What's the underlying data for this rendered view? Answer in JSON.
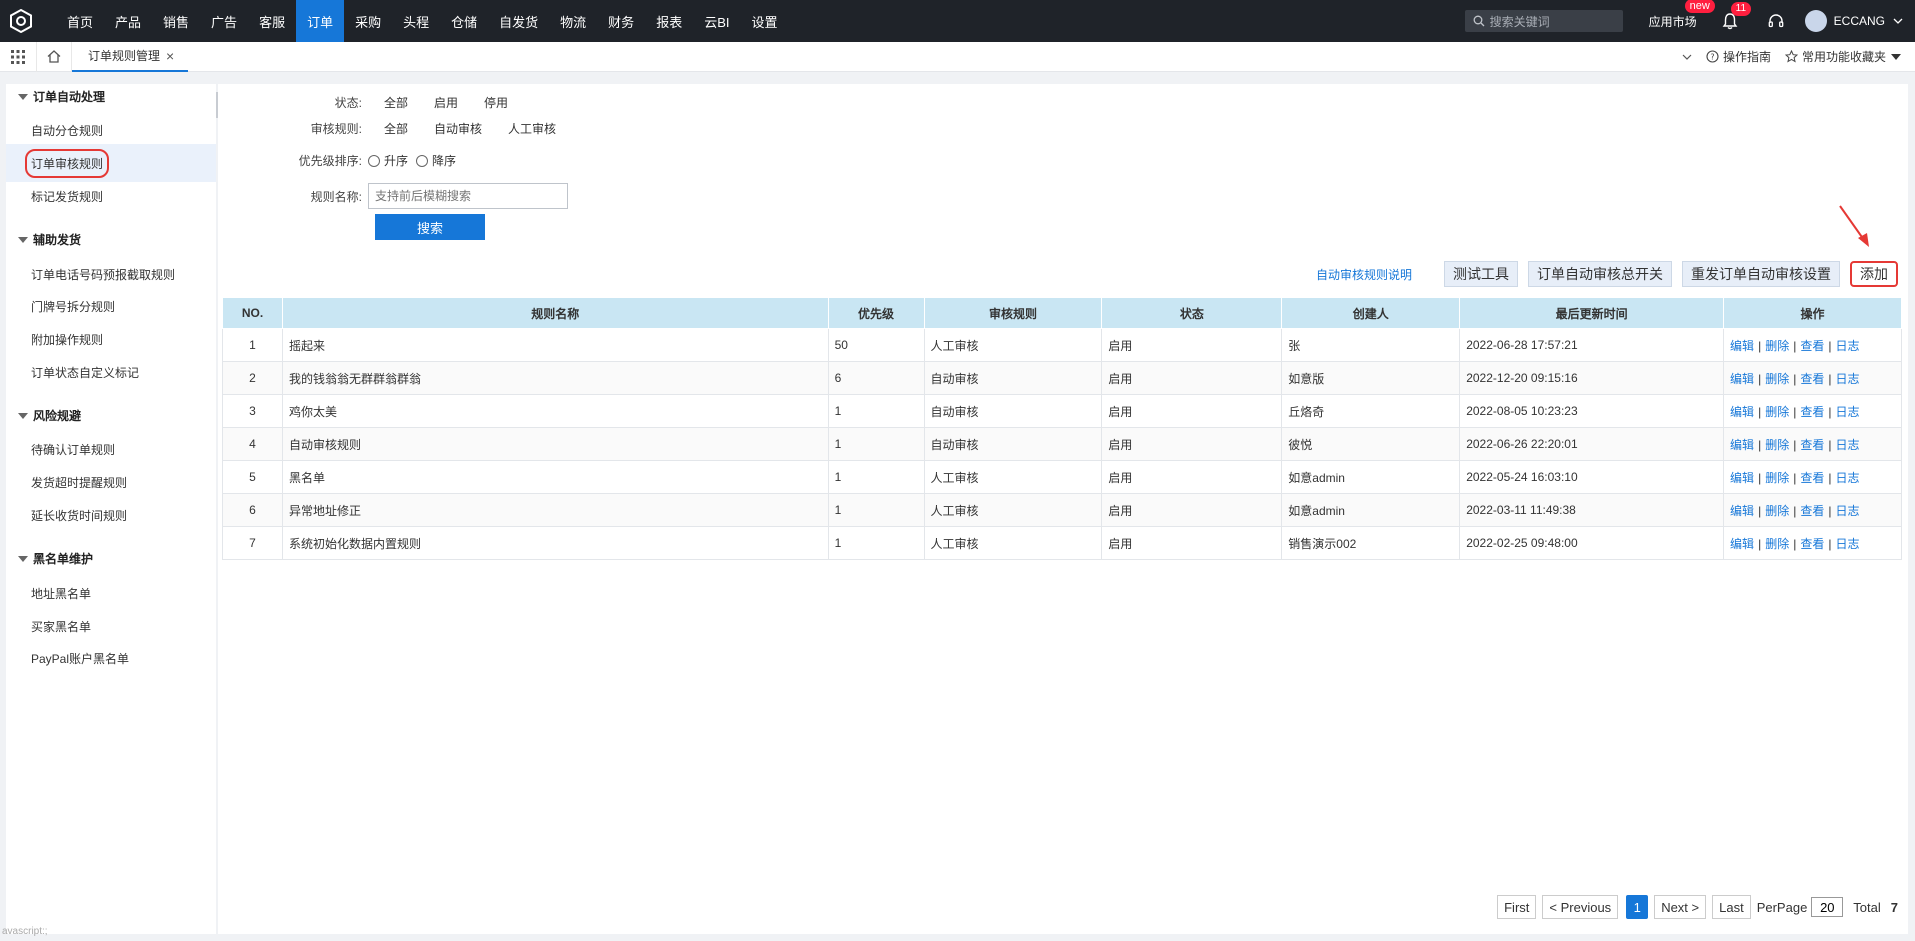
{
  "nav": {
    "menu": [
      "首页",
      "产品",
      "销售",
      "广告",
      "客服",
      "订单",
      "采购",
      "头程",
      "仓储",
      "自发货",
      "物流",
      "财务",
      "报表",
      "云BI",
      "设置"
    ],
    "active_index": 5,
    "search_placeholder": "搜索关键词",
    "app_market": "应用市场",
    "new_badge": "new",
    "notif_count": "11",
    "username": "ECCANG"
  },
  "tabbar": {
    "active_tab": "订单规则管理",
    "close": "×",
    "guide": "操作指南",
    "favorites": "常用功能收藏夹"
  },
  "sidebar": {
    "groups": [
      {
        "title": "订单自动处理",
        "items": [
          "自动分仓规则",
          "订单审核规则",
          "标记发货规则"
        ]
      },
      {
        "title": "辅助发货",
        "items": [
          "订单电话号码预报截取规则",
          "门牌号拆分规则",
          "附加操作规则",
          "订单状态自定义标记"
        ]
      },
      {
        "title": "风险规避",
        "items": [
          "待确认订单规则",
          "发货超时提醒规则",
          "延长收货时间规则"
        ]
      },
      {
        "title": "黑名单维护",
        "items": [
          "地址黑名单",
          "买家黑名单",
          "PayPal账户黑名单"
        ]
      }
    ],
    "active_item": "订单审核规则"
  },
  "filters": {
    "status_label": "状态:",
    "status_opts": [
      "全部",
      "启用",
      "停用"
    ],
    "rule_label": "审核规则:",
    "rule_opts": [
      "全部",
      "自动审核",
      "人工审核"
    ],
    "sort_label": "优先级排序:",
    "sort_asc": "升序",
    "sort_desc": "降序",
    "name_label": "规则名称:",
    "name_placeholder": "支持前后模糊搜索",
    "search_btn": "搜索"
  },
  "actions": {
    "help": "自动审核规则说明",
    "test_tool": "测试工具",
    "master_switch": "订单自动审核总开关",
    "resend": "重发订单自动审核设置",
    "add": "添加"
  },
  "table": {
    "headers": [
      "NO.",
      "规则名称",
      "优先级",
      "审核规则",
      "状态",
      "创建人",
      "最后更新时间",
      "操作"
    ],
    "rows": [
      [
        "1",
        "摇起来",
        "50",
        "人工审核",
        "启用",
        "张",
        "2022-06-28 17:57:21"
      ],
      [
        "2",
        "我的钱翁翁无群群翁群翁",
        "6",
        "自动审核",
        "启用",
        "如意版",
        "2022-12-20 09:15:16"
      ],
      [
        "3",
        "鸡你太美",
        "1",
        "自动审核",
        "启用",
        "丘烙奇",
        "2022-08-05 10:23:23"
      ],
      [
        "4",
        "自动审核规则",
        "1",
        "自动审核",
        "启用",
        "彼悦",
        "2022-06-26 22:20:01"
      ],
      [
        "5",
        "黑名单",
        "1",
        "人工审核",
        "启用",
        "如意admin",
        "2022-05-24 16:03:10"
      ],
      [
        "6",
        "异常地址修正",
        "1",
        "人工审核",
        "启用",
        "如意admin",
        "2022-03-11 11:49:38"
      ],
      [
        "7",
        "系统初始化数据内置规则",
        "1",
        "人工审核",
        "启用",
        "销售演示002",
        "2022-02-25 09:48:00"
      ]
    ],
    "ops": [
      "编辑",
      "删除",
      "查看",
      "日志"
    ],
    "sep": "|"
  },
  "pager": {
    "first": "First",
    "prev": "< Previous",
    "current": "1",
    "next": "Next >",
    "last": "Last",
    "perpage_label": "PerPage",
    "perpage": "20",
    "total_label": "Total",
    "total": "7"
  },
  "status_text": "avascript:;"
}
